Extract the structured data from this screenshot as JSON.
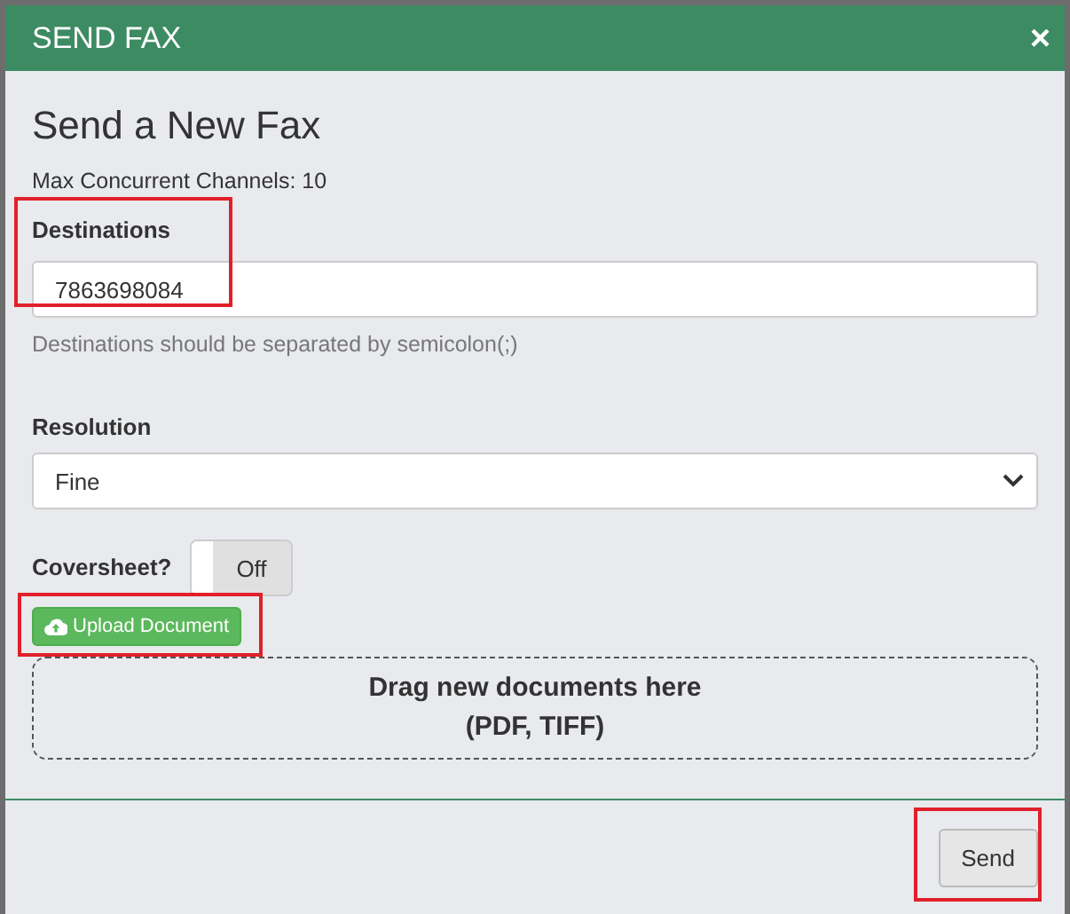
{
  "dialog": {
    "title": "SEND FAX",
    "close": "×"
  },
  "heading": "Send a New Fax",
  "max_channels": "Max Concurrent Channels: 10",
  "destinations": {
    "label": "Destinations",
    "value": "7863698084",
    "help": "Destinations should be separated by semicolon(;)",
    "highlighted": true
  },
  "resolution": {
    "label": "Resolution",
    "value": "Fine"
  },
  "coversheet": {
    "label": "Coversheet?",
    "state_text": "Off",
    "on": false
  },
  "upload": {
    "label": "Upload Document",
    "highlighted": true
  },
  "dropzone": {
    "lines": [
      "Drag new documents here",
      "(PDF, TIFF)"
    ]
  },
  "send": {
    "label": "Send",
    "highlighted": true
  }
}
